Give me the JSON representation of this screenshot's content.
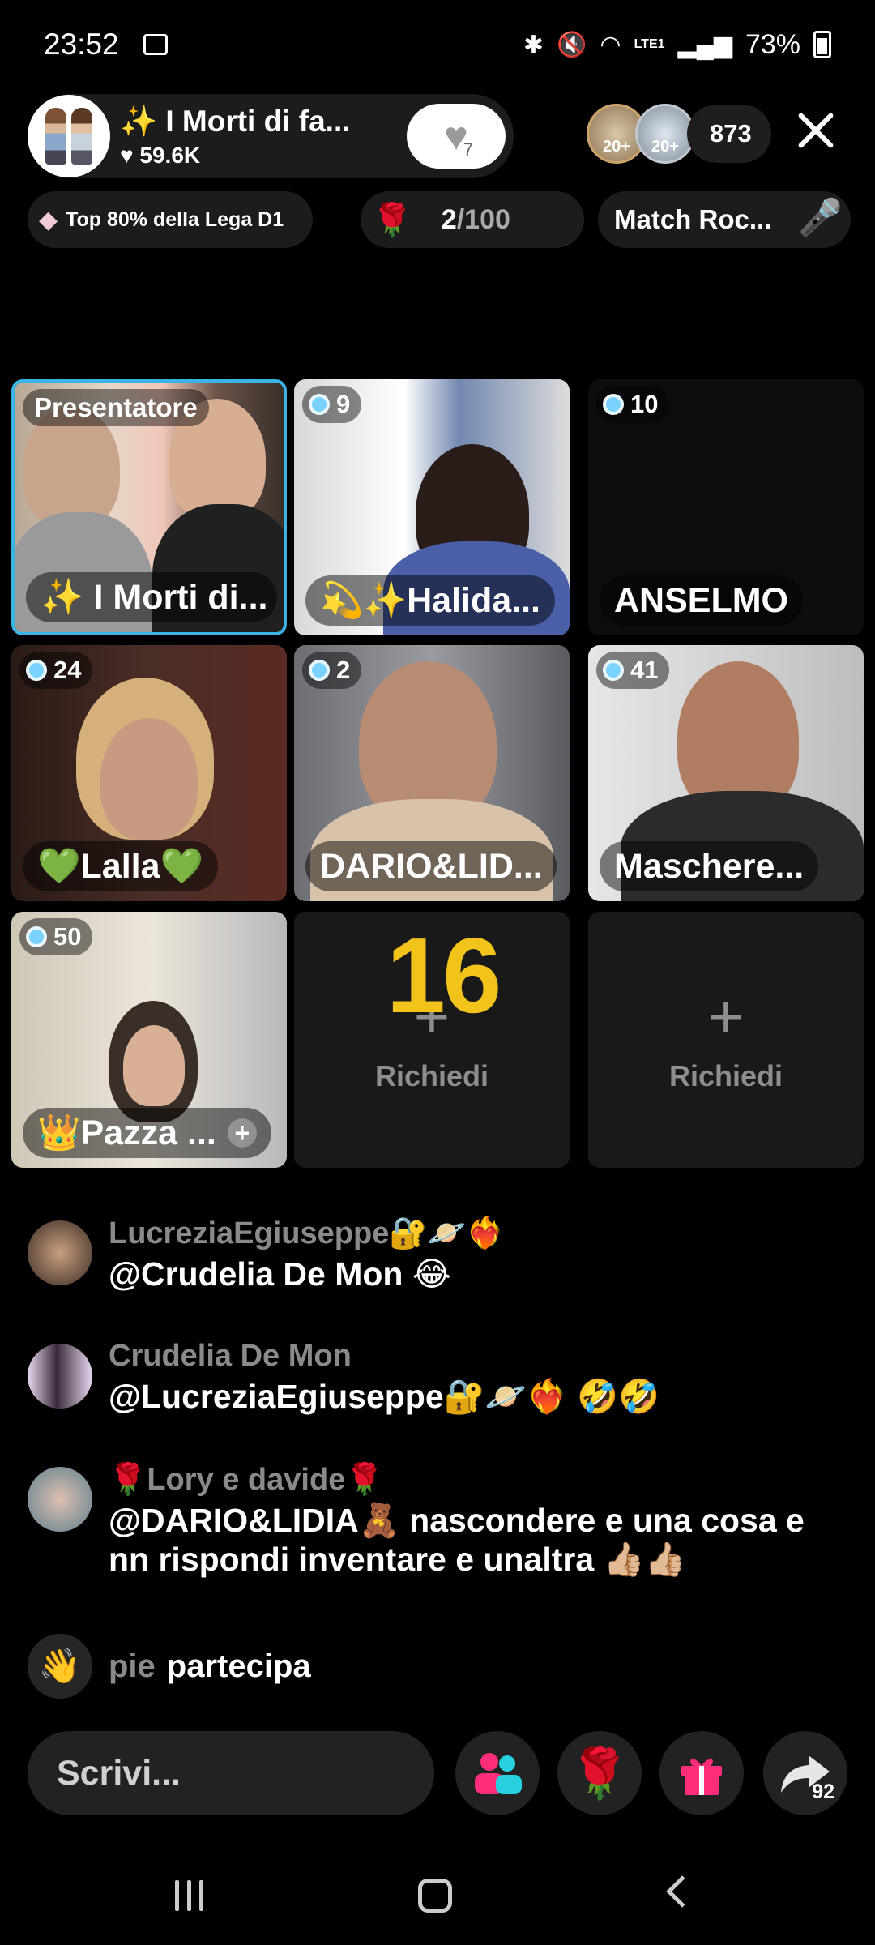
{
  "status_bar": {
    "time": "23:52",
    "battery": "73%",
    "network": "LTE1",
    "icons": [
      "screenshot-icon",
      "bluetooth-icon",
      "mute-icon",
      "wifi-icon",
      "signal-icon",
      "battery-icon"
    ]
  },
  "header": {
    "host_name": "✨ I Morti di fa...",
    "likes": "♥ 59.6K",
    "heart_count": "7",
    "viewer_badges": [
      "20+",
      "20+"
    ],
    "viewer_count": "873"
  },
  "chips": {
    "league": "Top 80% della Lega D1",
    "roses_current": "2",
    "roses_total": "/100",
    "match": "Match Roc..."
  },
  "grid": {
    "host_badge": "Presentatore",
    "tiles": [
      {
        "badge": "",
        "name": "✨ I Morti di..."
      },
      {
        "badge": "9",
        "name": "💫✨Halida..."
      },
      {
        "badge": "10",
        "name": "ANSELMO"
      },
      {
        "badge": "24",
        "name": "💚Lalla💚"
      },
      {
        "badge": "2",
        "name": "DARIO&LID..."
      },
      {
        "badge": "41",
        "name": "Maschere..."
      },
      {
        "badge": "50",
        "name": "👑Pazza ..."
      }
    ],
    "request_label": "Richiedi",
    "request_plus": "+",
    "overlay_number": "16"
  },
  "chat": {
    "messages": [
      {
        "user": "LucreziaEgiuseppe🔐🪐❤️‍🔥",
        "text": "@Crudelia De Mon 😂"
      },
      {
        "user": "Crudelia De Mon",
        "text": "@LucreziaEgiuseppe🔐🪐❤️‍🔥 🤣🤣"
      },
      {
        "user": "🌹Lory e davide🌹",
        "text": "@DARIO&LIDIA🧸 nascondere e una cosa e nn rispondi inventare e unaltra 👍🏼👍🏼"
      }
    ],
    "join_user": "pie",
    "join_action": "partecipa"
  },
  "bottom": {
    "compose_placeholder": "Scrivi...",
    "share_count": "92"
  },
  "colors": {
    "accent_blue": "#3ab3e5",
    "gold": "#f2c31a",
    "pink": "#ff2d7a"
  }
}
